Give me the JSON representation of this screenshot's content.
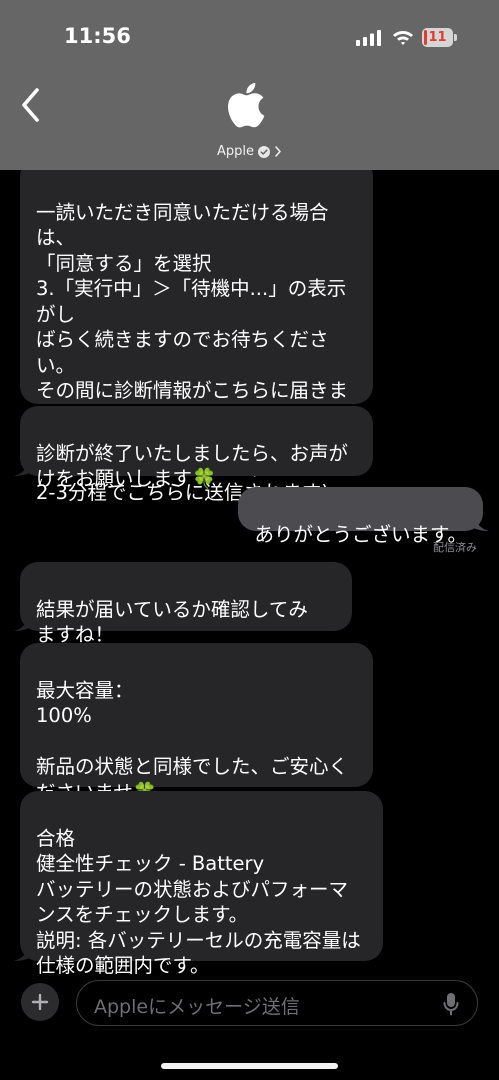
{
  "status_bar": {
    "time": "11:56",
    "battery": "11",
    "battery_level_percent": 11,
    "battery_color": "#e23b2f"
  },
  "header": {
    "contact_name": "Apple",
    "background": "#666666"
  },
  "messages": [
    {
      "direction": "incoming",
      "text": "一読いただき同意いただける場合は、\n「同意する」を選択\n3.「実行中」＞「待機中...」の表示がし\nばらく続きますのでお待ちください。\nその間に診断情報がこちらに届きま\nす。 待機中と表示されあましたら、\nこのチャット画面に戻っていただき\nお知らせくださいませ。(診断結果は\n2-3分程でこちらに送信されます)"
    },
    {
      "direction": "incoming",
      "text": "診断が終了いたしましたら、お声が\nけをお願いします🍀"
    },
    {
      "direction": "outgoing",
      "text": "ありがとうございます。"
    },
    {
      "direction": "incoming",
      "text": "結果が届いているか確認してみ\nますね！"
    },
    {
      "direction": "incoming",
      "text": "最大容量：\n100%\n\n新品の状態と同様でした、ご安心く\nださいませ🍀"
    },
    {
      "direction": "incoming",
      "text": "合格\n健全性チェック - Battery\nバッテリーの状態およびパフォーマ\nンスをチェックします。\n説明: 各バッテリーセルの充電容量は\n仕様の範囲内です。"
    }
  ],
  "delivered_label": "配信済み",
  "composer": {
    "placeholder": "Appleにメッセージ送信"
  },
  "colors": {
    "incoming_bubble": "#262629",
    "outgoing_bubble": "#4b4b50",
    "background": "#000000"
  }
}
